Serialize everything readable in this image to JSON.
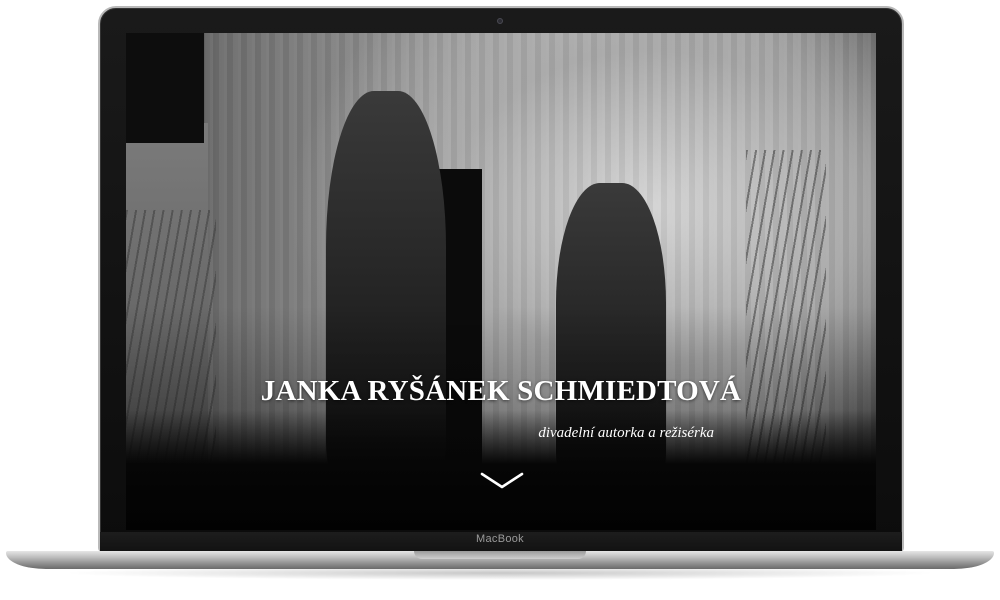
{
  "hero": {
    "name": "JANKA RYŠÁNEK SCHMIEDTOVÁ",
    "subtitle": "divadelní autorka a režisérka",
    "scroll_icon": "chevron-down-icon"
  },
  "device": {
    "brand": "MacBook"
  },
  "colors": {
    "text": "#ffffff",
    "bezel": "#111111",
    "frame": "#bdbdbd"
  }
}
